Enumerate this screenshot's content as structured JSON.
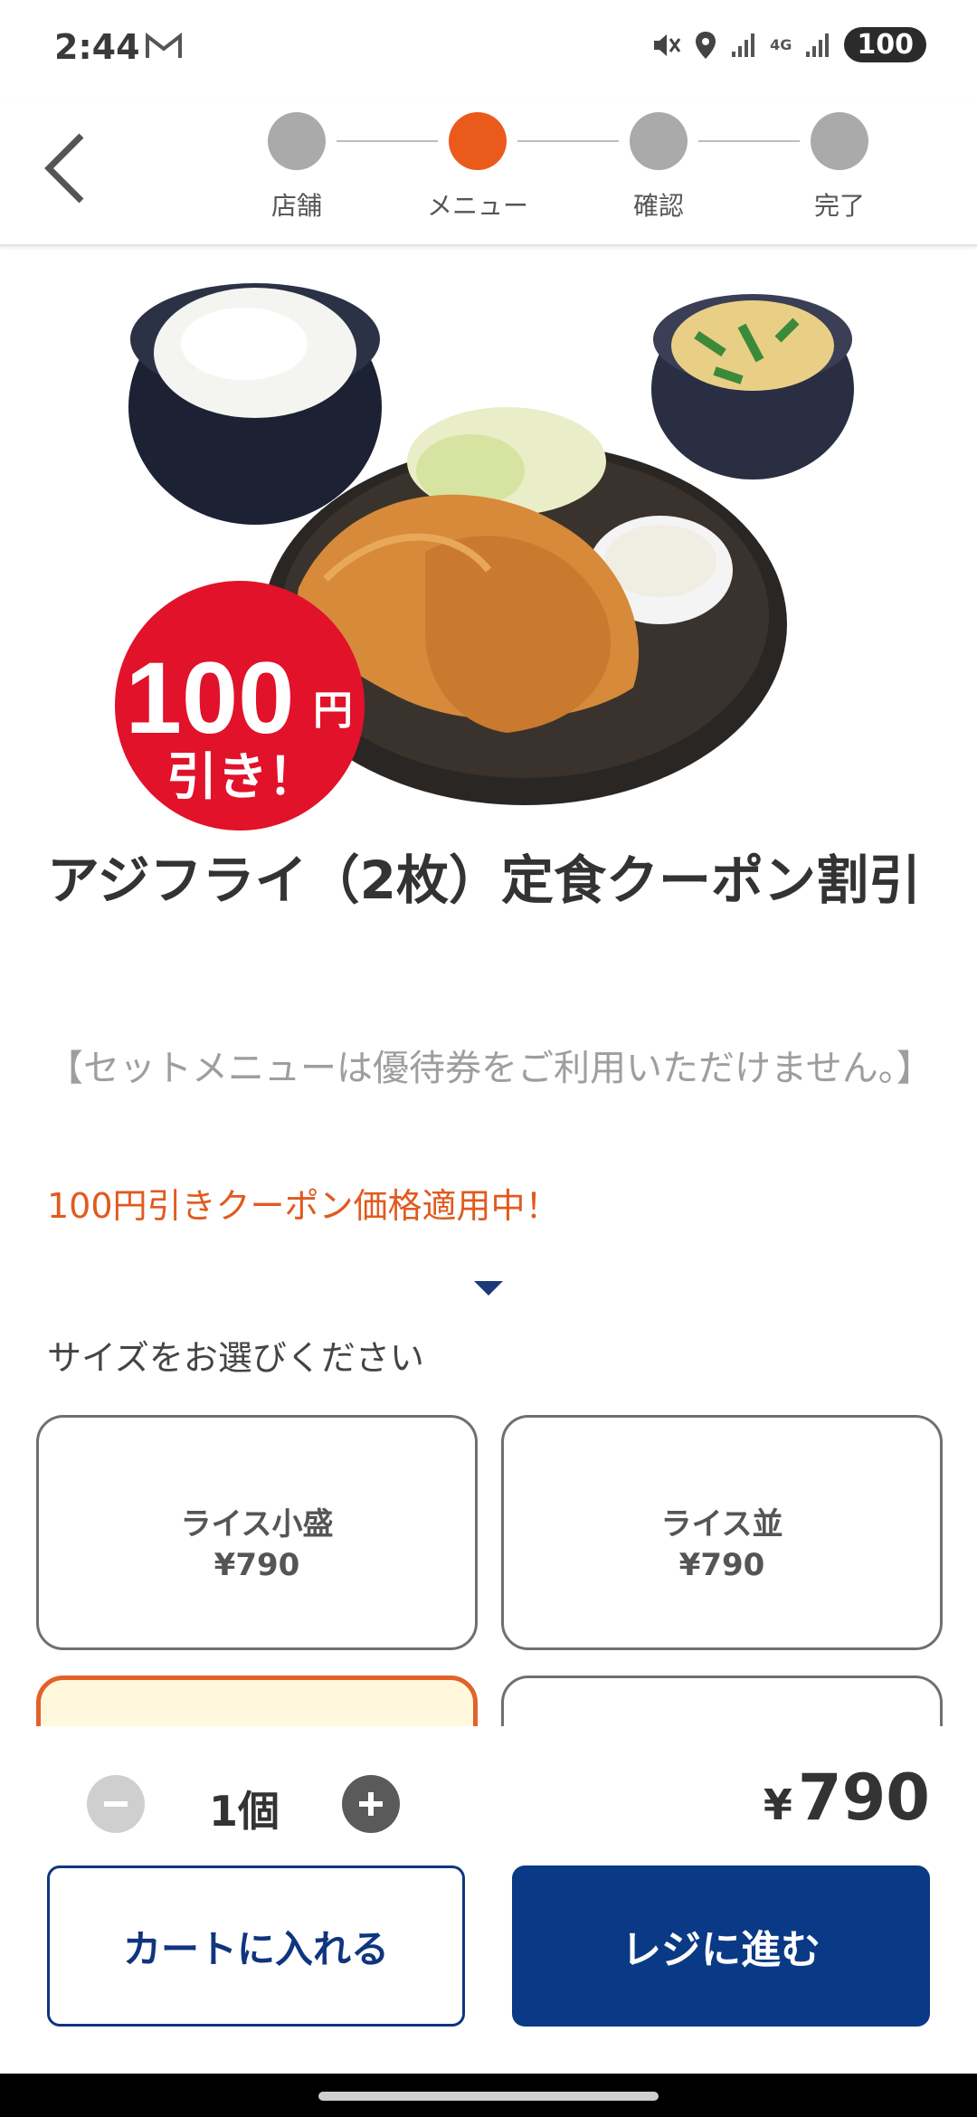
{
  "status_bar": {
    "time": "2:44",
    "network": "4G",
    "battery": "100"
  },
  "stepper": {
    "steps": [
      {
        "label": "店舗",
        "active": false
      },
      {
        "label": "メニュー",
        "active": true
      },
      {
        "label": "確認",
        "active": false
      },
      {
        "label": "完了",
        "active": false
      }
    ],
    "active_color": "#ea5a1b"
  },
  "hero": {
    "badge_main": "100",
    "badge_unit": "円",
    "badge_sub": "引き！"
  },
  "product": {
    "title": "アジフライ（2枚）定食クーポン割引",
    "note": "【セットメニューは優待券をご利用いただけません。】",
    "coupon_text": "100円引きクーポン価格適用中！"
  },
  "size_section": {
    "label": "サイズをお選びください",
    "options": [
      {
        "name": "ライス小盛",
        "price": "¥790"
      },
      {
        "name": "ライス並",
        "price": "¥790"
      },
      {
        "name": "",
        "price": ""
      },
      {
        "name": "",
        "price": ""
      }
    ]
  },
  "order": {
    "quantity": "1個",
    "currency": "¥",
    "total": "790",
    "cart_label": "カートに入れる",
    "checkout_label": "レジに進む"
  }
}
